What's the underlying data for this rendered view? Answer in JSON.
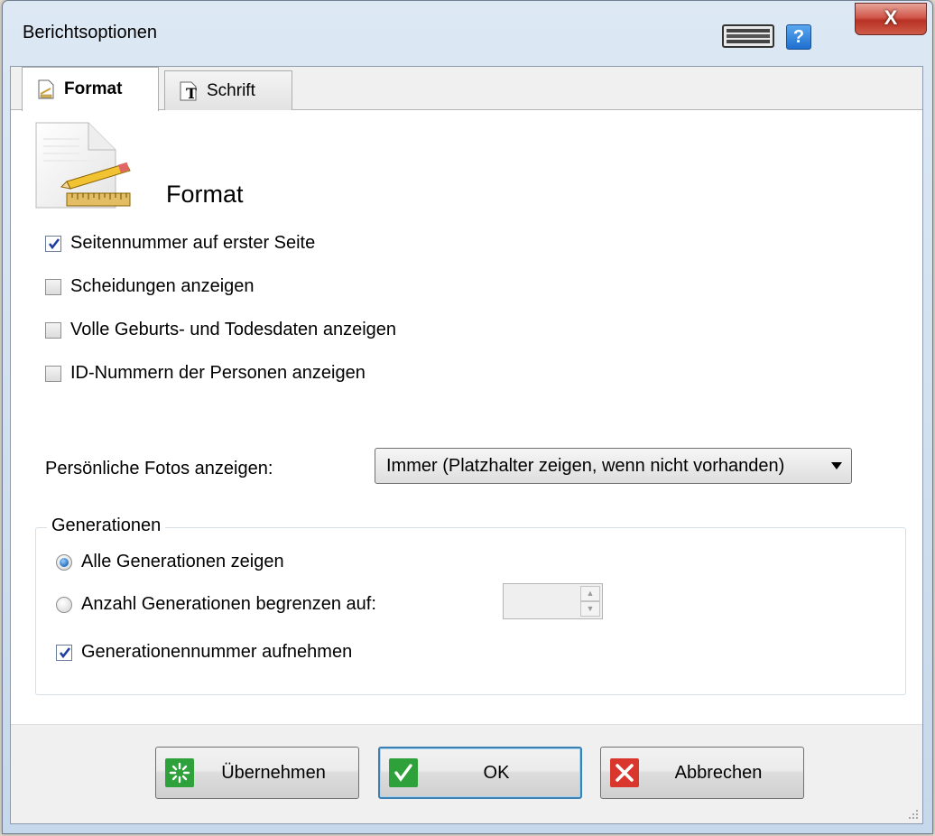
{
  "window": {
    "title": "Berichtsoptionen",
    "close_label": "X",
    "help_label": "?"
  },
  "tabs": [
    {
      "label": "Format",
      "icon": "format-page-icon",
      "active": true
    },
    {
      "label": "Schrift",
      "icon": "font-icon",
      "active": false
    }
  ],
  "header": {
    "title": "Format",
    "icon": "page-ruler-pencil-icon"
  },
  "options": [
    {
      "label": "Seitennummer auf erster Seite",
      "checked": true
    },
    {
      "label": "Scheidungen anzeigen",
      "checked": false
    },
    {
      "label": "Volle Geburts- und Todesdaten anzeigen",
      "checked": false
    },
    {
      "label": "ID-Nummern der Personen anzeigen",
      "checked": false
    }
  ],
  "photos": {
    "label": "Persönliche Fotos anzeigen:",
    "selected": "Immer (Platzhalter zeigen, wenn nicht vorhanden)"
  },
  "generations": {
    "group_label": "Generationen",
    "all_label": "Alle Generationen zeigen",
    "all_selected": true,
    "limit_label": "Anzahl Generationen begrenzen auf:",
    "limit_selected": false,
    "limit_value": "",
    "include_number_label": "Generationennummer aufnehmen",
    "include_number_checked": true
  },
  "buttons": {
    "apply": {
      "label": "Übernehmen",
      "icon": "apply-sparkle-icon",
      "color": "#2ea13a"
    },
    "ok": {
      "label": "OK",
      "icon": "checkmark-icon",
      "color": "#2ea13a"
    },
    "cancel": {
      "label": "Abbrechen",
      "icon": "cancel-x-icon",
      "color": "#d9372d"
    }
  }
}
